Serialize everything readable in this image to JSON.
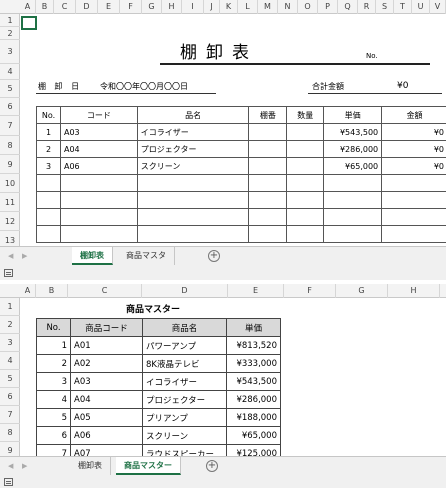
{
  "top_sheet": {
    "columns": [
      "A",
      "B",
      "C",
      "D",
      "E",
      "F",
      "G",
      "H",
      "I",
      "J",
      "K",
      "L",
      "M",
      "N",
      "O",
      "P",
      "Q",
      "R",
      "S",
      "T",
      "U",
      "V"
    ],
    "rows": [
      "1",
      "2",
      "3",
      "4",
      "5",
      "6",
      "7",
      "8",
      "9",
      "10",
      "11",
      "12",
      "13"
    ],
    "title": "棚卸表",
    "no_label": "No.",
    "date_label": "棚 卸 日",
    "date_value": "令和〇〇年〇〇月〇〇日",
    "total_label": "合計金額",
    "total_value": "¥0",
    "headers": [
      "No.",
      "コード",
      "品名",
      "棚番",
      "数量",
      "単価",
      "金額"
    ],
    "items": [
      {
        "no": "1",
        "code": "A03",
        "name": "イコライザー",
        "price": "¥543,500",
        "amount": "¥0"
      },
      {
        "no": "2",
        "code": "A04",
        "name": "プロジェクター",
        "price": "¥286,000",
        "amount": "¥0"
      },
      {
        "no": "3",
        "code": "A06",
        "name": "スクリーン",
        "price": "¥65,000",
        "amount": "¥0"
      }
    ],
    "tabs": {
      "inventory": "棚卸表",
      "master": "商品マスタ"
    }
  },
  "bottom_sheet": {
    "columns": [
      "A",
      "B",
      "C",
      "D",
      "E",
      "F",
      "G",
      "H"
    ],
    "rows": [
      "1",
      "2",
      "3",
      "4",
      "5",
      "6",
      "7",
      "8",
      "9"
    ],
    "title": "商品マスター",
    "headers": [
      "No.",
      "商品コード",
      "商品名",
      "単価"
    ],
    "items": [
      {
        "no": "1",
        "code": "A01",
        "name": "パワーアンプ",
        "price": "¥813,520"
      },
      {
        "no": "2",
        "code": "A02",
        "name": "8K液晶テレビ",
        "price": "¥333,000"
      },
      {
        "no": "3",
        "code": "A03",
        "name": "イコライザー",
        "price": "¥543,500"
      },
      {
        "no": "4",
        "code": "A04",
        "name": "プロジェクター",
        "price": "¥286,000"
      },
      {
        "no": "5",
        "code": "A05",
        "name": "プリアンプ",
        "price": "¥188,000"
      },
      {
        "no": "6",
        "code": "A06",
        "name": "スクリーン",
        "price": "¥65,000"
      },
      {
        "no": "7",
        "code": "A07",
        "name": "ラウドスピーカー",
        "price": "¥125,000"
      }
    ],
    "tabs": {
      "inventory": "棚卸表",
      "master": "商品マスター"
    }
  }
}
